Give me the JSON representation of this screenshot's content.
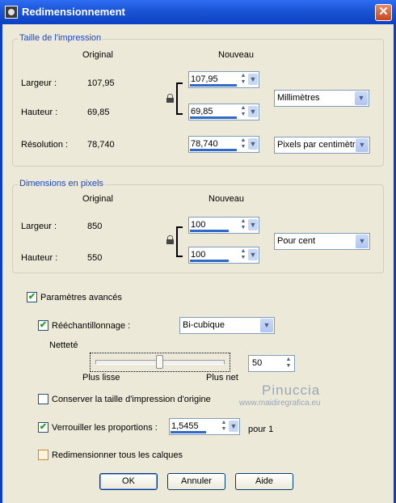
{
  "window": {
    "title": "Redimensionnement",
    "close_glyph": "✕"
  },
  "print_size": {
    "title": "Taille de l'impression",
    "col_original": "Original",
    "col_new": "Nouveau",
    "width_label": "Largeur :",
    "width_original": "107,95",
    "width_new": "107,95",
    "height_label": "Hauteur :",
    "height_original": "69,85",
    "height_new": "69,85",
    "resolution_label": "Résolution :",
    "resolution_original": "78,740",
    "resolution_new": "78,740",
    "unit_select": "Millimètres",
    "res_unit_select": "Pixels par centimètre"
  },
  "pixel_dims": {
    "title": "Dimensions en pixels",
    "col_original": "Original",
    "col_new": "Nouveau",
    "width_label": "Largeur :",
    "width_original": "850",
    "width_new": "100",
    "height_label": "Hauteur :",
    "height_original": "550",
    "height_new": "100",
    "unit_select": "Pour cent"
  },
  "advanced": {
    "label": "Paramètres avancés",
    "checked": true,
    "resample_label": "Rééchantillonnage :",
    "resample_checked": true,
    "resample_method": "Bi-cubique",
    "sharpness_label": "Netteté",
    "sharpness_value": "50",
    "sharpness_level": 0.5,
    "slider_left_label": "Plus lisse",
    "slider_right_label": "Plus net",
    "keep_print_size_label": "Conserver la taille d'impression d'origine",
    "keep_print_size_checked": false,
    "lock_ratio_label": "Verrouiller les proportions :",
    "lock_ratio_checked": true,
    "ratio_value": "1,5455",
    "ratio_suffix": "pour 1",
    "resize_all_layers_label": "Redimensionner tous les calques",
    "resize_all_layers_checked": false
  },
  "buttons": {
    "ok": "OK",
    "cancel": "Annuler",
    "help": "Aide"
  },
  "watermark": {
    "line1": "Pinuccia",
    "line2": "www.maidiregrafica.eu"
  },
  "icons": {
    "app": "app-icon",
    "close": "close-icon",
    "lock": "lock-icon",
    "spin": "spin-arrows-icon",
    "dropdown": "chevron-down-icon",
    "check": "checkmark-icon"
  }
}
